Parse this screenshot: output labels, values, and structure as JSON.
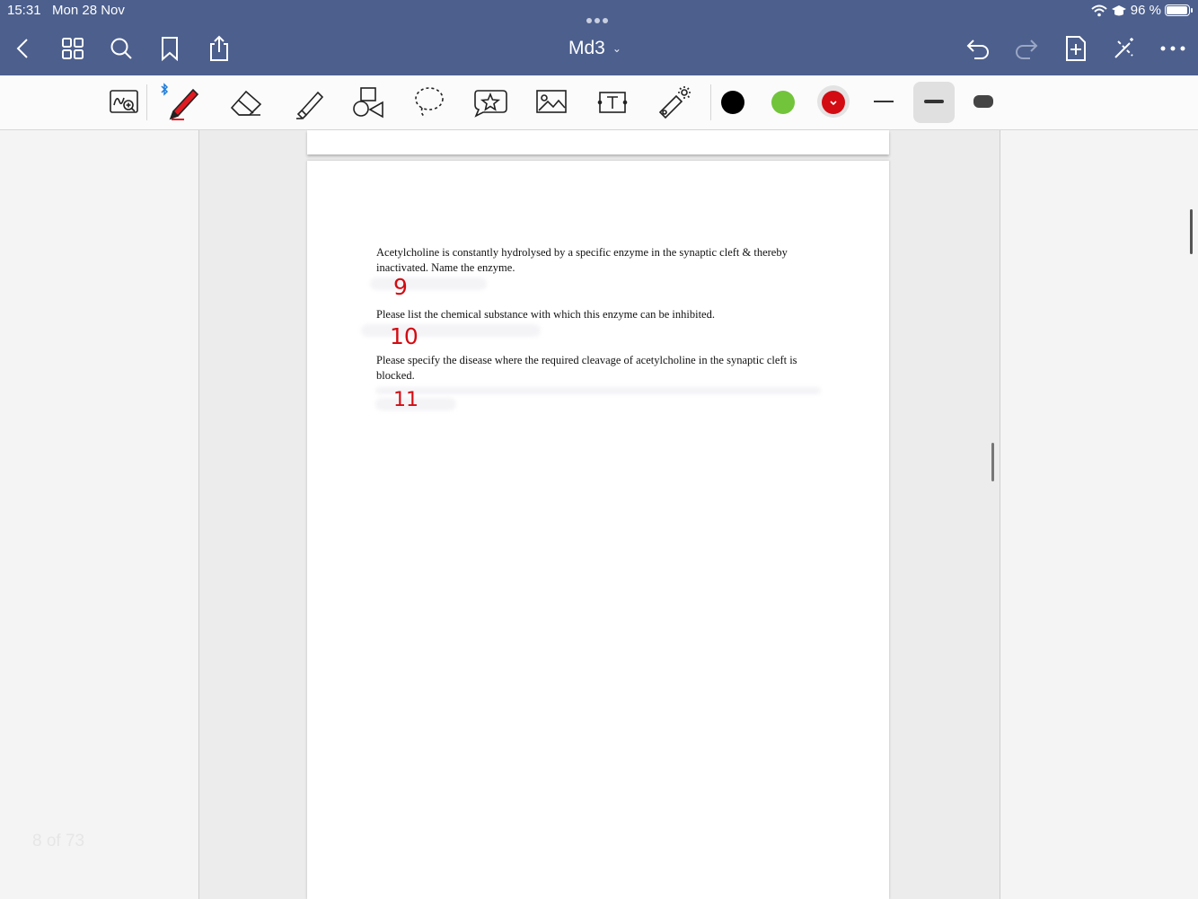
{
  "status": {
    "time": "15:31",
    "date": "Mon 28 Nov",
    "battery": "96 %"
  },
  "nav": {
    "title": "Md3",
    "icons": [
      "back-icon",
      "thumbnails-icon",
      "search-icon",
      "bookmark-icon",
      "share-icon",
      "undo-icon",
      "redo-icon",
      "add-page-icon",
      "close-pen-icon",
      "more-icon"
    ]
  },
  "toolbar": {
    "tools": [
      "zoom-window-icon",
      "pen-icon",
      "eraser-icon",
      "highlighter-icon",
      "shapes-icon",
      "lasso-icon",
      "elements-icon",
      "image-icon",
      "text-icon",
      "laser-pointer-icon"
    ],
    "colors": {
      "black": "#000000",
      "green": "#72c43a",
      "red": "#d20c12"
    },
    "selected_color": "red",
    "stroke_widths": [
      "thin",
      "medium",
      "thick"
    ],
    "selected_stroke": "medium"
  },
  "document": {
    "questions": [
      {
        "text": "Acetylcholine is constantly hydrolysed by a specific enzyme in the synaptic cleft & thereby inactivated. Name the enzyme.",
        "handwritten_number": "9"
      },
      {
        "text": "Please list the chemical substance with which this enzyme can be inhibited.",
        "handwritten_number": "10"
      },
      {
        "text": "Please specify the disease where the required cleavage of acetylcholine in the synaptic cleft is blocked.",
        "handwritten_number": "11"
      }
    ],
    "page_counter": "8 of 73"
  }
}
